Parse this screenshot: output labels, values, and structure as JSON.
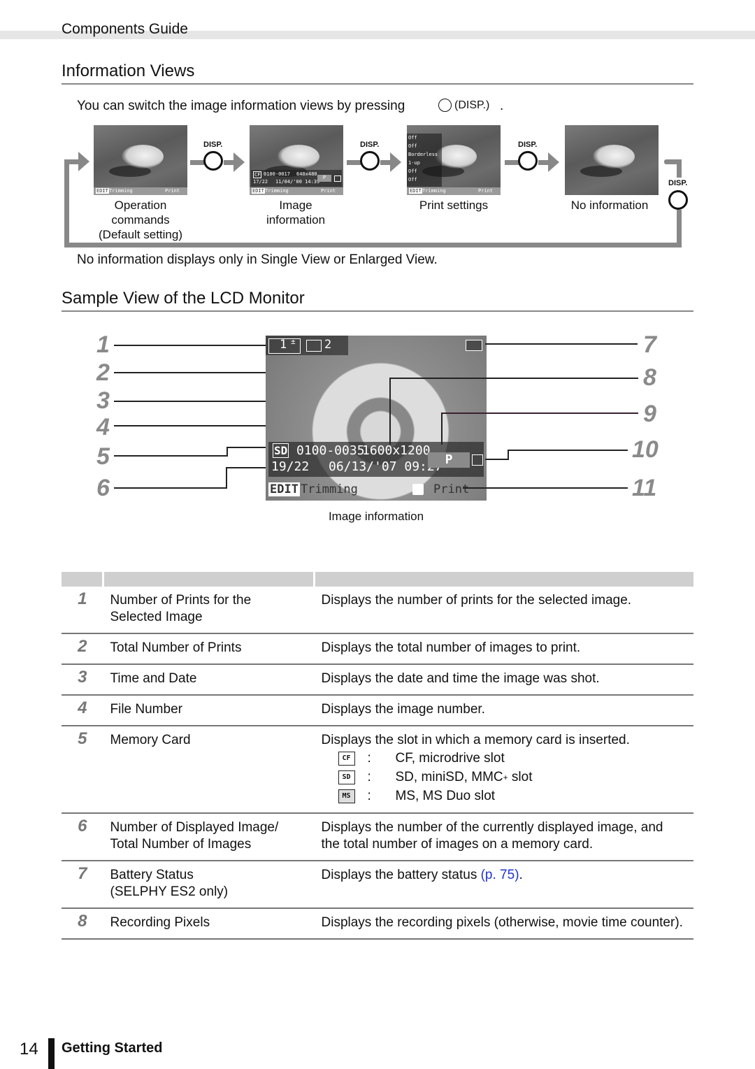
{
  "header": {
    "section_title": "Components Guide"
  },
  "information_views": {
    "heading": "Information Views",
    "intro_text": "You can switch the image information views by pressing",
    "intro_button_label": "(DISP.)",
    "intro_suffix": ".",
    "disp_label": "DISP.",
    "views": [
      {
        "caption_lines": [
          "Operation",
          "commands",
          "(Default setting)"
        ],
        "screen": {
          "edit": "EDIT",
          "trimming": "Trimming",
          "print": "Print"
        }
      },
      {
        "caption_lines": [
          "Image",
          "information"
        ],
        "screen": {
          "slot": "CF",
          "file_number": "0100-0017",
          "pixels": "640x480",
          "image_count": "17/22",
          "datetime": "11/04/'00 14:39",
          "mode": "P",
          "edit": "EDIT",
          "trimming": "Trimming",
          "print": "Print"
        }
      },
      {
        "caption_lines": [
          "Print settings"
        ],
        "screen": {
          "settings": [
            "Off",
            "Off",
            "Borderless",
            "1-up",
            "Off",
            "Off"
          ],
          "edit": "EDIT",
          "trimming": "Trimming",
          "print": "Print"
        }
      },
      {
        "caption_lines": [
          "No information"
        ],
        "screen": {}
      }
    ],
    "note": "No information displays only in Single View or Enlarged View."
  },
  "sample_view": {
    "heading": "Sample View of the LCD Monitor",
    "caption": "Image information",
    "callouts_left": [
      "1",
      "2",
      "3",
      "4",
      "5",
      "6"
    ],
    "callouts_right": [
      "7",
      "8",
      "9",
      "10",
      "11"
    ],
    "lcd": {
      "prints_count": "1",
      "total_prints": "2",
      "slot": "SD",
      "file_number": "0100-0035",
      "pixels": "1600x1200",
      "image_count": "19/22",
      "datetime": "06/13/'07 09:27",
      "mode": "P",
      "edit": "EDIT",
      "trimming": "Trimming",
      "print": "Print"
    }
  },
  "table": {
    "rows": [
      {
        "num": "1",
        "name": [
          "Number of Prints for the",
          "Selected Image"
        ],
        "desc": [
          "Displays the number of prints for the selected image."
        ]
      },
      {
        "num": "2",
        "name": [
          "Total Number of Prints"
        ],
        "desc": [
          "Displays the total number of images to print."
        ]
      },
      {
        "num": "3",
        "name": [
          "Time and Date"
        ],
        "desc": [
          "Displays the date and time the image was shot."
        ]
      },
      {
        "num": "4",
        "name": [
          "File Number"
        ],
        "desc": [
          "Displays the image number."
        ]
      },
      {
        "num": "5",
        "name": [
          "Memory Card"
        ],
        "desc": [
          "Displays the slot in which a memory card is inserted."
        ],
        "slots": [
          {
            "icon": "CF",
            "colon": ":",
            "text": "CF, microdrive slot"
          },
          {
            "icon": "SD",
            "colon": ":",
            "text": "SD, miniSD, MMC",
            "sup": "+",
            "suffix": " slot"
          },
          {
            "icon": "MS",
            "colon": ":",
            "text": "MS, MS Duo slot"
          }
        ]
      },
      {
        "num": "6",
        "name": [
          "Number of Displayed Image/",
          "Total Number of Images"
        ],
        "desc": [
          "Displays the number of the currently displayed image, and",
          "the total number of images on a memory card."
        ]
      },
      {
        "num": "7",
        "name": [
          "Battery Status",
          "(SELPHY ES2 only)"
        ],
        "desc_prefix": "Displays the battery status ",
        "desc_link": "(p. 75)",
        "desc_suffix": "."
      },
      {
        "num": "8",
        "name": [
          "Recording Pixels"
        ],
        "desc": [
          "Displays the recording pixels (otherwise, movie time counter)."
        ]
      }
    ]
  },
  "footer": {
    "page_number": "14",
    "section": "Getting Started"
  },
  "colors": {
    "link": "#2233cc",
    "callout_number": "#8a8a8a",
    "header_band": "#e6e6e6",
    "table_header": "#cfcfcf"
  }
}
